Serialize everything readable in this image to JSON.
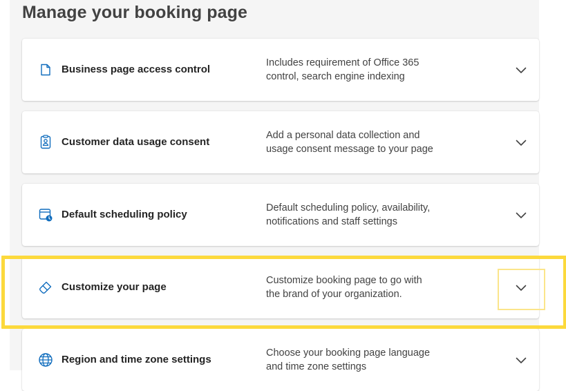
{
  "page": {
    "title": "Manage your booking page"
  },
  "cards": [
    {
      "title": "Business page access control",
      "desc_line1": "Includes requirement of Office 365",
      "desc_line2": "control, search engine indexing",
      "icon": "document-icon"
    },
    {
      "title": "Customer data usage consent",
      "desc_line1": "Add a personal data collection and",
      "desc_line2": "usage consent message to your page",
      "icon": "clipboard-person-icon"
    },
    {
      "title": "Default scheduling policy",
      "desc_line1": "Default scheduling policy, availability,",
      "desc_line2": "notifications and staff settings",
      "icon": "calendar-clock-icon"
    },
    {
      "title": "Customize your page",
      "desc_line1": "Customize booking page to go with",
      "desc_line2": "the brand of your organization.",
      "icon": "paintbrush-icon"
    },
    {
      "title": "Region and time zone settings",
      "desc_line1": "Choose your booking page language",
      "desc_line2": "and time zone settings",
      "icon": "globe-icon"
    }
  ],
  "colors": {
    "accent": "#0f6cbd",
    "highlight": "#fcd93c",
    "panel_bg": "#f5f5f5"
  }
}
